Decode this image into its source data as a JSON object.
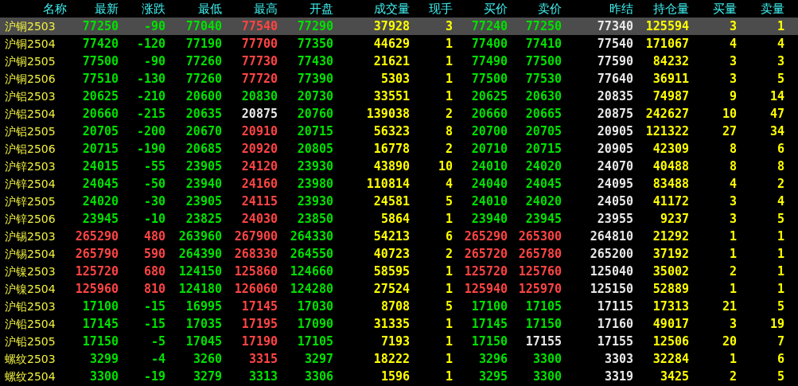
{
  "columns": [
    "名称",
    "最新",
    "涨跌",
    "最低",
    "最高",
    "开盘",
    "成交量",
    "现手",
    "买价",
    "卖价",
    "昨结",
    "持仓量",
    "买量",
    "卖量"
  ],
  "rows": [
    {
      "name": "沪铜2503",
      "selected": true,
      "cells": [
        {
          "text": "77250",
          "color": "#00e000"
        },
        {
          "text": "-90",
          "color": "#00e000"
        },
        {
          "text": "77040",
          "color": "#00e000"
        },
        {
          "text": "77540",
          "color": "#ff4444"
        },
        {
          "text": "77290",
          "color": "#00e000"
        },
        {
          "text": "37928",
          "color": "#ffff00"
        },
        {
          "text": "3",
          "color": "#ffff00"
        },
        {
          "text": "77240",
          "color": "#00e000"
        },
        {
          "text": "77250",
          "color": "#00e000"
        },
        {
          "text": "77340",
          "color": "#e8e8e8"
        },
        {
          "text": "125594",
          "color": "#ffff00"
        },
        {
          "text": "3",
          "color": "#ffff00"
        },
        {
          "text": "1",
          "color": "#ffff00"
        }
      ]
    },
    {
      "name": "沪铜2504",
      "selected": false,
      "cells": [
        {
          "text": "77420",
          "color": "#00e000"
        },
        {
          "text": "-120",
          "color": "#00e000"
        },
        {
          "text": "77190",
          "color": "#00e000"
        },
        {
          "text": "77700",
          "color": "#ff4444"
        },
        {
          "text": "77350",
          "color": "#00e000"
        },
        {
          "text": "44629",
          "color": "#ffff00"
        },
        {
          "text": "1",
          "color": "#ffff00"
        },
        {
          "text": "77400",
          "color": "#00e000"
        },
        {
          "text": "77410",
          "color": "#00e000"
        },
        {
          "text": "77540",
          "color": "#e8e8e8"
        },
        {
          "text": "171067",
          "color": "#ffff00"
        },
        {
          "text": "4",
          "color": "#ffff00"
        },
        {
          "text": "4",
          "color": "#ffff00"
        }
      ]
    },
    {
      "name": "沪铜2505",
      "selected": false,
      "cells": [
        {
          "text": "77500",
          "color": "#00e000"
        },
        {
          "text": "-90",
          "color": "#00e000"
        },
        {
          "text": "77260",
          "color": "#00e000"
        },
        {
          "text": "77730",
          "color": "#ff4444"
        },
        {
          "text": "77430",
          "color": "#00e000"
        },
        {
          "text": "21621",
          "color": "#ffff00"
        },
        {
          "text": "1",
          "color": "#ffff00"
        },
        {
          "text": "77490",
          "color": "#00e000"
        },
        {
          "text": "77500",
          "color": "#00e000"
        },
        {
          "text": "77590",
          "color": "#e8e8e8"
        },
        {
          "text": "84232",
          "color": "#ffff00"
        },
        {
          "text": "3",
          "color": "#ffff00"
        },
        {
          "text": "3",
          "color": "#ffff00"
        }
      ]
    },
    {
      "name": "沪铜2506",
      "selected": false,
      "cells": [
        {
          "text": "77510",
          "color": "#00e000"
        },
        {
          "text": "-130",
          "color": "#00e000"
        },
        {
          "text": "77260",
          "color": "#00e000"
        },
        {
          "text": "77720",
          "color": "#ff4444"
        },
        {
          "text": "77390",
          "color": "#00e000"
        },
        {
          "text": "5303",
          "color": "#ffff00"
        },
        {
          "text": "1",
          "color": "#ffff00"
        },
        {
          "text": "77500",
          "color": "#00e000"
        },
        {
          "text": "77530",
          "color": "#00e000"
        },
        {
          "text": "77640",
          "color": "#e8e8e8"
        },
        {
          "text": "36911",
          "color": "#ffff00"
        },
        {
          "text": "3",
          "color": "#ffff00"
        },
        {
          "text": "5",
          "color": "#ffff00"
        }
      ]
    },
    {
      "name": "沪铝2503",
      "selected": false,
      "cells": [
        {
          "text": "20625",
          "color": "#00e000"
        },
        {
          "text": "-210",
          "color": "#00e000"
        },
        {
          "text": "20600",
          "color": "#00e000"
        },
        {
          "text": "20830",
          "color": "#00e000"
        },
        {
          "text": "20730",
          "color": "#00e000"
        },
        {
          "text": "33551",
          "color": "#ffff00"
        },
        {
          "text": "1",
          "color": "#ffff00"
        },
        {
          "text": "20625",
          "color": "#00e000"
        },
        {
          "text": "20630",
          "color": "#00e000"
        },
        {
          "text": "20835",
          "color": "#e8e8e8"
        },
        {
          "text": "74987",
          "color": "#ffff00"
        },
        {
          "text": "9",
          "color": "#ffff00"
        },
        {
          "text": "14",
          "color": "#ffff00"
        }
      ]
    },
    {
      "name": "沪铝2504",
      "selected": false,
      "cells": [
        {
          "text": "20660",
          "color": "#00e000"
        },
        {
          "text": "-215",
          "color": "#00e000"
        },
        {
          "text": "20635",
          "color": "#00e000"
        },
        {
          "text": "20875",
          "color": "#e8e8e8"
        },
        {
          "text": "20760",
          "color": "#00e000"
        },
        {
          "text": "139038",
          "color": "#ffff00"
        },
        {
          "text": "2",
          "color": "#ffff00"
        },
        {
          "text": "20660",
          "color": "#00e000"
        },
        {
          "text": "20665",
          "color": "#00e000"
        },
        {
          "text": "20875",
          "color": "#e8e8e8"
        },
        {
          "text": "242627",
          "color": "#ffff00"
        },
        {
          "text": "10",
          "color": "#ffff00"
        },
        {
          "text": "47",
          "color": "#ffff00"
        }
      ]
    },
    {
      "name": "沪铝2505",
      "selected": false,
      "cells": [
        {
          "text": "20705",
          "color": "#00e000"
        },
        {
          "text": "-200",
          "color": "#00e000"
        },
        {
          "text": "20670",
          "color": "#00e000"
        },
        {
          "text": "20910",
          "color": "#ff4444"
        },
        {
          "text": "20715",
          "color": "#00e000"
        },
        {
          "text": "56323",
          "color": "#ffff00"
        },
        {
          "text": "8",
          "color": "#ffff00"
        },
        {
          "text": "20700",
          "color": "#00e000"
        },
        {
          "text": "20705",
          "color": "#00e000"
        },
        {
          "text": "20905",
          "color": "#e8e8e8"
        },
        {
          "text": "121322",
          "color": "#ffff00"
        },
        {
          "text": "27",
          "color": "#ffff00"
        },
        {
          "text": "34",
          "color": "#ffff00"
        }
      ]
    },
    {
      "name": "沪铝2506",
      "selected": false,
      "cells": [
        {
          "text": "20715",
          "color": "#00e000"
        },
        {
          "text": "-190",
          "color": "#00e000"
        },
        {
          "text": "20685",
          "color": "#00e000"
        },
        {
          "text": "20920",
          "color": "#ff4444"
        },
        {
          "text": "20805",
          "color": "#00e000"
        },
        {
          "text": "16778",
          "color": "#ffff00"
        },
        {
          "text": "2",
          "color": "#ffff00"
        },
        {
          "text": "20710",
          "color": "#00e000"
        },
        {
          "text": "20715",
          "color": "#00e000"
        },
        {
          "text": "20905",
          "color": "#e8e8e8"
        },
        {
          "text": "42309",
          "color": "#ffff00"
        },
        {
          "text": "8",
          "color": "#ffff00"
        },
        {
          "text": "6",
          "color": "#ffff00"
        }
      ]
    },
    {
      "name": "沪锌2503",
      "selected": false,
      "cells": [
        {
          "text": "24015",
          "color": "#00e000"
        },
        {
          "text": "-55",
          "color": "#00e000"
        },
        {
          "text": "23905",
          "color": "#00e000"
        },
        {
          "text": "24120",
          "color": "#ff4444"
        },
        {
          "text": "23930",
          "color": "#00e000"
        },
        {
          "text": "43890",
          "color": "#ffff00"
        },
        {
          "text": "10",
          "color": "#ffff00"
        },
        {
          "text": "24010",
          "color": "#00e000"
        },
        {
          "text": "24020",
          "color": "#00e000"
        },
        {
          "text": "24070",
          "color": "#e8e8e8"
        },
        {
          "text": "40488",
          "color": "#ffff00"
        },
        {
          "text": "8",
          "color": "#ffff00"
        },
        {
          "text": "8",
          "color": "#ffff00"
        }
      ]
    },
    {
      "name": "沪锌2504",
      "selected": false,
      "cells": [
        {
          "text": "24045",
          "color": "#00e000"
        },
        {
          "text": "-50",
          "color": "#00e000"
        },
        {
          "text": "23940",
          "color": "#00e000"
        },
        {
          "text": "24160",
          "color": "#ff4444"
        },
        {
          "text": "23980",
          "color": "#00e000"
        },
        {
          "text": "110814",
          "color": "#ffff00"
        },
        {
          "text": "4",
          "color": "#ffff00"
        },
        {
          "text": "24040",
          "color": "#00e000"
        },
        {
          "text": "24045",
          "color": "#00e000"
        },
        {
          "text": "24095",
          "color": "#e8e8e8"
        },
        {
          "text": "83488",
          "color": "#ffff00"
        },
        {
          "text": "4",
          "color": "#ffff00"
        },
        {
          "text": "2",
          "color": "#ffff00"
        }
      ]
    },
    {
      "name": "沪锌2505",
      "selected": false,
      "cells": [
        {
          "text": "24020",
          "color": "#00e000"
        },
        {
          "text": "-30",
          "color": "#00e000"
        },
        {
          "text": "23905",
          "color": "#00e000"
        },
        {
          "text": "24115",
          "color": "#ff4444"
        },
        {
          "text": "23930",
          "color": "#00e000"
        },
        {
          "text": "24581",
          "color": "#ffff00"
        },
        {
          "text": "5",
          "color": "#ffff00"
        },
        {
          "text": "24010",
          "color": "#00e000"
        },
        {
          "text": "24020",
          "color": "#00e000"
        },
        {
          "text": "24050",
          "color": "#e8e8e8"
        },
        {
          "text": "41172",
          "color": "#ffff00"
        },
        {
          "text": "3",
          "color": "#ffff00"
        },
        {
          "text": "4",
          "color": "#ffff00"
        }
      ]
    },
    {
      "name": "沪锌2506",
      "selected": false,
      "cells": [
        {
          "text": "23945",
          "color": "#00e000"
        },
        {
          "text": "-10",
          "color": "#00e000"
        },
        {
          "text": "23825",
          "color": "#00e000"
        },
        {
          "text": "24030",
          "color": "#ff4444"
        },
        {
          "text": "23850",
          "color": "#00e000"
        },
        {
          "text": "5864",
          "color": "#ffff00"
        },
        {
          "text": "1",
          "color": "#ffff00"
        },
        {
          "text": "23940",
          "color": "#00e000"
        },
        {
          "text": "23945",
          "color": "#00e000"
        },
        {
          "text": "23955",
          "color": "#e8e8e8"
        },
        {
          "text": "9237",
          "color": "#ffff00"
        },
        {
          "text": "3",
          "color": "#ffff00"
        },
        {
          "text": "5",
          "color": "#ffff00"
        }
      ]
    },
    {
      "name": "沪锡2503",
      "selected": false,
      "cells": [
        {
          "text": "265290",
          "color": "#ff4444"
        },
        {
          "text": "480",
          "color": "#ff4444"
        },
        {
          "text": "263960",
          "color": "#00e000"
        },
        {
          "text": "267900",
          "color": "#ff4444"
        },
        {
          "text": "264330",
          "color": "#00e000"
        },
        {
          "text": "54213",
          "color": "#ffff00"
        },
        {
          "text": "6",
          "color": "#ffff00"
        },
        {
          "text": "265290",
          "color": "#ff4444"
        },
        {
          "text": "265300",
          "color": "#ff4444"
        },
        {
          "text": "264810",
          "color": "#e8e8e8"
        },
        {
          "text": "21292",
          "color": "#ffff00"
        },
        {
          "text": "1",
          "color": "#ffff00"
        },
        {
          "text": "1",
          "color": "#ffff00"
        }
      ]
    },
    {
      "name": "沪锡2504",
      "selected": false,
      "cells": [
        {
          "text": "265790",
          "color": "#ff4444"
        },
        {
          "text": "590",
          "color": "#ff4444"
        },
        {
          "text": "264390",
          "color": "#00e000"
        },
        {
          "text": "268330",
          "color": "#ff4444"
        },
        {
          "text": "264550",
          "color": "#00e000"
        },
        {
          "text": "40723",
          "color": "#ffff00"
        },
        {
          "text": "2",
          "color": "#ffff00"
        },
        {
          "text": "265720",
          "color": "#ff4444"
        },
        {
          "text": "265780",
          "color": "#ff4444"
        },
        {
          "text": "265200",
          "color": "#e8e8e8"
        },
        {
          "text": "37192",
          "color": "#ffff00"
        },
        {
          "text": "1",
          "color": "#ffff00"
        },
        {
          "text": "1",
          "color": "#ffff00"
        }
      ]
    },
    {
      "name": "沪镍2503",
      "selected": false,
      "cells": [
        {
          "text": "125720",
          "color": "#ff4444"
        },
        {
          "text": "680",
          "color": "#ff4444"
        },
        {
          "text": "124150",
          "color": "#00e000"
        },
        {
          "text": "125860",
          "color": "#ff4444"
        },
        {
          "text": "124660",
          "color": "#00e000"
        },
        {
          "text": "58595",
          "color": "#ffff00"
        },
        {
          "text": "1",
          "color": "#ffff00"
        },
        {
          "text": "125720",
          "color": "#ff4444"
        },
        {
          "text": "125760",
          "color": "#ff4444"
        },
        {
          "text": "125040",
          "color": "#e8e8e8"
        },
        {
          "text": "35002",
          "color": "#ffff00"
        },
        {
          "text": "2",
          "color": "#ffff00"
        },
        {
          "text": "1",
          "color": "#ffff00"
        }
      ]
    },
    {
      "name": "沪镍2504",
      "selected": false,
      "cells": [
        {
          "text": "125960",
          "color": "#ff4444"
        },
        {
          "text": "810",
          "color": "#ff4444"
        },
        {
          "text": "124180",
          "color": "#00e000"
        },
        {
          "text": "126060",
          "color": "#ff4444"
        },
        {
          "text": "124280",
          "color": "#00e000"
        },
        {
          "text": "27524",
          "color": "#ffff00"
        },
        {
          "text": "1",
          "color": "#ffff00"
        },
        {
          "text": "125940",
          "color": "#ff4444"
        },
        {
          "text": "125970",
          "color": "#ff4444"
        },
        {
          "text": "125150",
          "color": "#e8e8e8"
        },
        {
          "text": "52889",
          "color": "#ffff00"
        },
        {
          "text": "1",
          "color": "#ffff00"
        },
        {
          "text": "1",
          "color": "#ffff00"
        }
      ]
    },
    {
      "name": "沪铅2503",
      "selected": false,
      "cells": [
        {
          "text": "17100",
          "color": "#00e000"
        },
        {
          "text": "-15",
          "color": "#00e000"
        },
        {
          "text": "16995",
          "color": "#00e000"
        },
        {
          "text": "17145",
          "color": "#ff4444"
        },
        {
          "text": "17030",
          "color": "#00e000"
        },
        {
          "text": "8708",
          "color": "#ffff00"
        },
        {
          "text": "5",
          "color": "#ffff00"
        },
        {
          "text": "17100",
          "color": "#00e000"
        },
        {
          "text": "17105",
          "color": "#00e000"
        },
        {
          "text": "17115",
          "color": "#e8e8e8"
        },
        {
          "text": "17313",
          "color": "#ffff00"
        },
        {
          "text": "21",
          "color": "#ffff00"
        },
        {
          "text": "5",
          "color": "#ffff00"
        }
      ]
    },
    {
      "name": "沪铅2504",
      "selected": false,
      "cells": [
        {
          "text": "17145",
          "color": "#00e000"
        },
        {
          "text": "-15",
          "color": "#00e000"
        },
        {
          "text": "17035",
          "color": "#00e000"
        },
        {
          "text": "17195",
          "color": "#ff4444"
        },
        {
          "text": "17090",
          "color": "#00e000"
        },
        {
          "text": "31335",
          "color": "#ffff00"
        },
        {
          "text": "1",
          "color": "#ffff00"
        },
        {
          "text": "17145",
          "color": "#00e000"
        },
        {
          "text": "17150",
          "color": "#00e000"
        },
        {
          "text": "17160",
          "color": "#e8e8e8"
        },
        {
          "text": "49017",
          "color": "#ffff00"
        },
        {
          "text": "3",
          "color": "#ffff00"
        },
        {
          "text": "19",
          "color": "#ffff00"
        }
      ]
    },
    {
      "name": "沪铅2505",
      "selected": false,
      "cells": [
        {
          "text": "17150",
          "color": "#00e000"
        },
        {
          "text": "-5",
          "color": "#00e000"
        },
        {
          "text": "17045",
          "color": "#00e000"
        },
        {
          "text": "17190",
          "color": "#ff4444"
        },
        {
          "text": "17105",
          "color": "#00e000"
        },
        {
          "text": "7193",
          "color": "#ffff00"
        },
        {
          "text": "1",
          "color": "#ffff00"
        },
        {
          "text": "17150",
          "color": "#00e000"
        },
        {
          "text": "17155",
          "color": "#e8e8e8"
        },
        {
          "text": "17155",
          "color": "#e8e8e8"
        },
        {
          "text": "12506",
          "color": "#ffff00"
        },
        {
          "text": "20",
          "color": "#ffff00"
        },
        {
          "text": "7",
          "color": "#ffff00"
        }
      ]
    },
    {
      "name": "螺纹2503",
      "selected": false,
      "cells": [
        {
          "text": "3299",
          "color": "#00e000"
        },
        {
          "text": "-4",
          "color": "#00e000"
        },
        {
          "text": "3260",
          "color": "#00e000"
        },
        {
          "text": "3315",
          "color": "#ff4444"
        },
        {
          "text": "3297",
          "color": "#00e000"
        },
        {
          "text": "18222",
          "color": "#ffff00"
        },
        {
          "text": "1",
          "color": "#ffff00"
        },
        {
          "text": "3296",
          "color": "#00e000"
        },
        {
          "text": "3300",
          "color": "#00e000"
        },
        {
          "text": "3303",
          "color": "#e8e8e8"
        },
        {
          "text": "32284",
          "color": "#ffff00"
        },
        {
          "text": "1",
          "color": "#ffff00"
        },
        {
          "text": "6",
          "color": "#ffff00"
        }
      ]
    },
    {
      "name": "螺纹2504",
      "selected": false,
      "cells": [
        {
          "text": "3300",
          "color": "#00e000"
        },
        {
          "text": "-19",
          "color": "#00e000"
        },
        {
          "text": "3279",
          "color": "#00e000"
        },
        {
          "text": "3313",
          "color": "#00e000"
        },
        {
          "text": "3306",
          "color": "#00e000"
        },
        {
          "text": "1596",
          "color": "#ffff00"
        },
        {
          "text": "1",
          "color": "#ffff00"
        },
        {
          "text": "3295",
          "color": "#00e000"
        },
        {
          "text": "3300",
          "color": "#00e000"
        },
        {
          "text": "3319",
          "color": "#e8e8e8"
        },
        {
          "text": "3425",
          "color": "#ffff00"
        },
        {
          "text": "2",
          "color": "#ffff00"
        },
        {
          "text": "5",
          "color": "#ffff00"
        }
      ]
    }
  ]
}
